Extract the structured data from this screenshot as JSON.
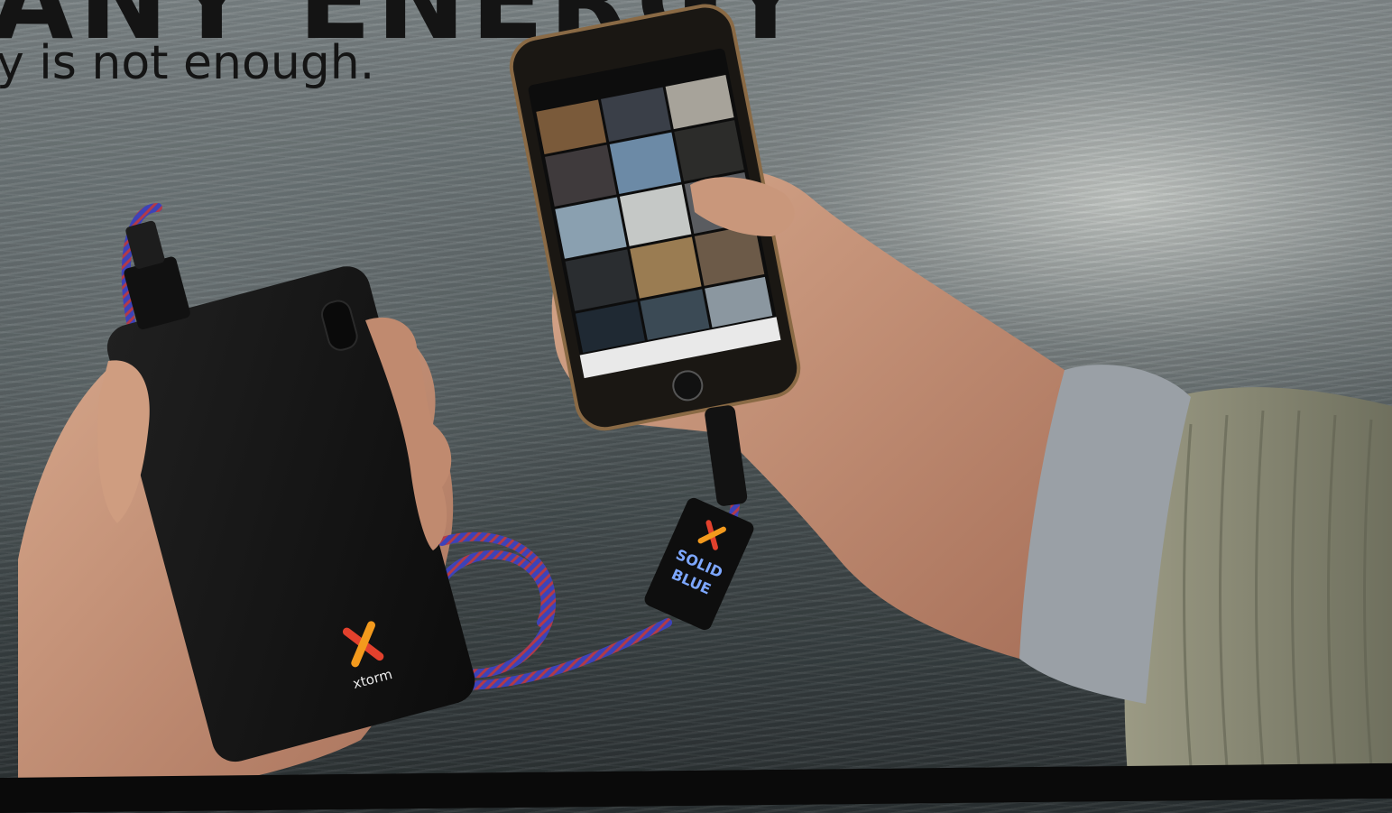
{
  "headline_fragment": "ANY ENERGY",
  "tagline": "y is not enough.",
  "powerbank": {
    "brand_label": "xtorm"
  },
  "cable_tag": {
    "line1": "SOLID",
    "line2": "BLUE"
  },
  "colors": {
    "powerbank_body": "#151515",
    "cable_blue": "#3d43b8",
    "cable_red": "#b23a48",
    "logo_orange": "#f39a1d",
    "logo_red": "#e2412d",
    "sleeve_green_gray": "#8b8c78",
    "knit_cuff": "#9aa0a6",
    "skin": "#c49378"
  }
}
